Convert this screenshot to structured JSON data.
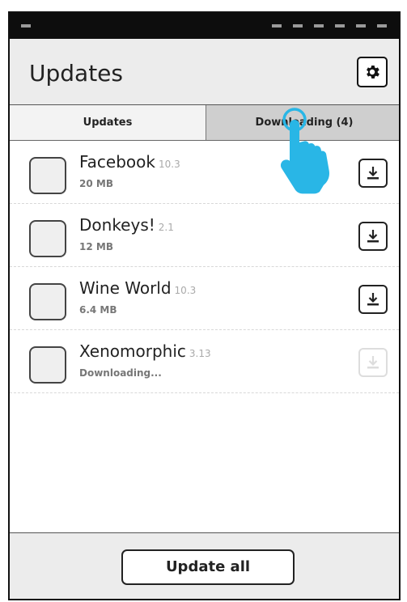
{
  "header": {
    "title": "Updates",
    "settings_icon": "gear-icon"
  },
  "tabs": [
    {
      "label": "Updates",
      "selected": false
    },
    {
      "label": "Downloading (4)",
      "selected": true
    }
  ],
  "apps": [
    {
      "name": "Facebook",
      "version": "10.3",
      "size": "20 MB",
      "icon": "download-icon",
      "enabled": true
    },
    {
      "name": "Donkeys!",
      "version": "2.1",
      "size": "12 MB",
      "icon": "download-icon",
      "enabled": true
    },
    {
      "name": "Wine World",
      "version": "10.3",
      "size": "6.4 MB",
      "icon": "download-icon",
      "enabled": true
    },
    {
      "name": "Xenomorphic",
      "version": "3.13",
      "size": "Downloading...",
      "icon": "download-icon",
      "enabled": false
    }
  ],
  "footer": {
    "update_all_label": "Update all"
  },
  "colors": {
    "header_bg": "#ececec",
    "tab_selected_bg": "#cfcfcf",
    "touch_hint": "#29b6e6"
  }
}
